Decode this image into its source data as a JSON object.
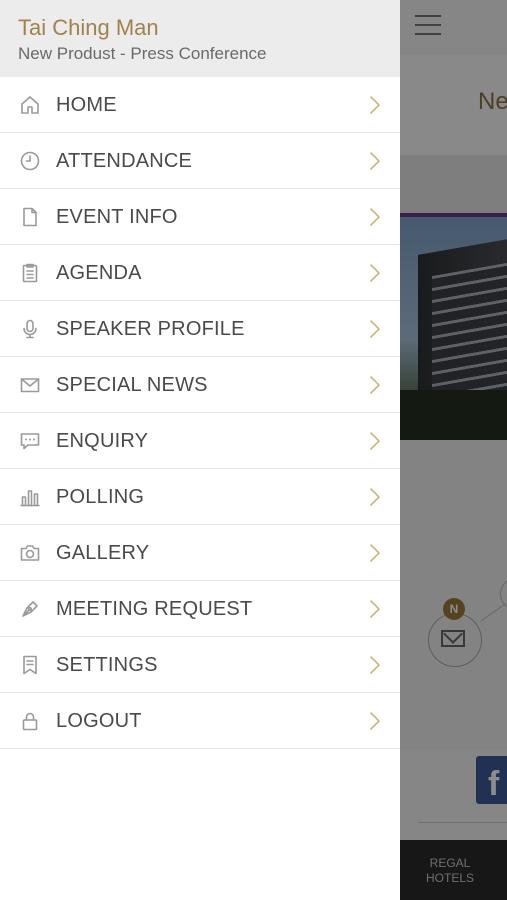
{
  "drawer": {
    "user_name": "Tai Ching Man",
    "event_name": "New Produst - Press Conference",
    "items": [
      {
        "label": "HOME",
        "icon": "home-icon"
      },
      {
        "label": "ATTENDANCE",
        "icon": "clock-icon"
      },
      {
        "label": "EVENT INFO",
        "icon": "document-icon"
      },
      {
        "label": "AGENDA",
        "icon": "clipboard-icon"
      },
      {
        "label": "SPEAKER PROFILE",
        "icon": "microphone-icon"
      },
      {
        "label": "SPECIAL NEWS",
        "icon": "envelope-icon"
      },
      {
        "label": "ENQUIRY",
        "icon": "chat-bubble-icon"
      },
      {
        "label": "POLLING",
        "icon": "bar-chart-icon"
      },
      {
        "label": "GALLERY",
        "icon": "camera-icon"
      },
      {
        "label": "MEETING REQUEST",
        "icon": "pen-nib-icon"
      },
      {
        "label": "SETTINGS",
        "icon": "bookmark-icon"
      },
      {
        "label": "LOGOUT",
        "icon": "lock-icon"
      }
    ]
  },
  "background": {
    "header_title_partial": "Ne",
    "badge_letter": "N",
    "tab_label": "REGAL\nHOTELS"
  },
  "colors": {
    "accent_gold": "#a2824b",
    "chevron": "#c8b87a",
    "icon_gray": "#9a9a9a"
  }
}
